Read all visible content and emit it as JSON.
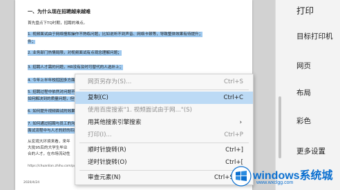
{
  "document": {
    "heading": "一、为什么现在招聘越来越难",
    "intro": "首先盘点下TQ时期，招聘的难点。",
    "items": [
      "1. 视频面试由于网络慢和操作不熟练问题，比如说听不到声音、网络卡顿等，导致整体效果有待提升；",
      "2. 业务部门热情局限，对视频面试有点观念理解问题；",
      "3. 招聘人才需的问题，HR没有及时可替代的人选补上；",
      "4. 今年上半年校招因多方面原因没法正常进行；",
      "5. 招聘过程中依然对问题不一样；",
      "如何解决到的质量问题，但仍然是个问题；",
      "6. 如何提升视频面试的效果；",
      "7. 如何通过招聘与员工的沟通，让企业在疫情期间",
      "面试流程中与人才的好的匹配。"
    ],
    "para_lines": [
      "从宏观大环境来看，来年",
      "大批95后的大学生毕业",
      "合的人才，在市场流动性"
    ],
    "source": "https://chuanlian.zhihu.com/p/107301608",
    "date": "2020/4/24"
  },
  "context_menu": {
    "items": [
      {
        "label": "网页另存为(S)...",
        "shortcut": "Ctrl+S",
        "state": "disabled"
      },
      {
        "label": "复制(C)",
        "shortcut": "Ctrl+C",
        "state": "selected"
      },
      {
        "label": "使用百度搜索\"1. 视频面试由于网...\"(S)",
        "shortcut": "",
        "state": "disabled"
      },
      {
        "label": "用其他搜索引擎搜索",
        "shortcut": "",
        "state": "normal"
      },
      {
        "label": "打印(I)...",
        "shortcut": "Ctrl+P",
        "state": "disabled"
      },
      {
        "label": "顺时针旋转(R)",
        "shortcut": "Ctrl+]",
        "state": "normal"
      },
      {
        "label": "逆时针旋转(O)",
        "shortcut": "Ctrl+[",
        "state": "normal"
      },
      {
        "label": "审查元素(N)",
        "shortcut": "Ctrl+Shift",
        "state": "normal"
      }
    ],
    "submenu_arrow": "›"
  },
  "print_panel": {
    "title": "打印",
    "options": [
      "目标打印机",
      "网页",
      "布局",
      "彩色",
      "更多设置"
    ]
  },
  "watermark": {
    "title": "windows系统城",
    "subtitle": "www.wxclgg.com"
  }
}
